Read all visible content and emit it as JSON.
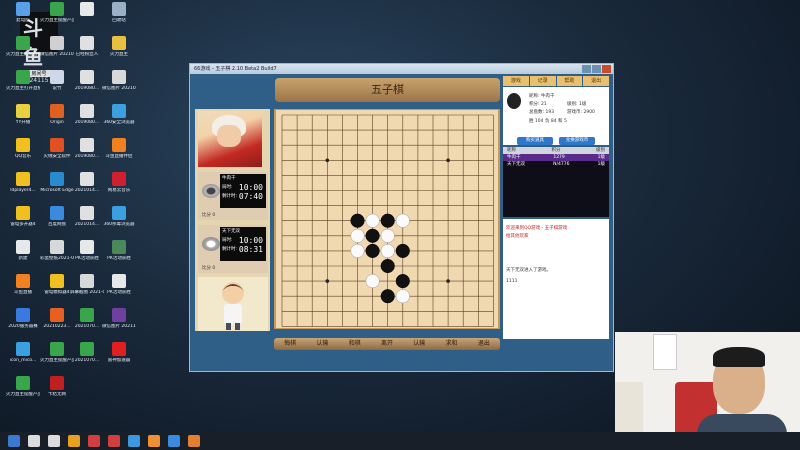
{
  "desktop": {
    "logo": {
      "big": "斗鱼",
      "small": "房间号",
      "room": "24115"
    },
    "icons": [
      {
        "label": "此电脑",
        "color": "#5aa0e8"
      },
      {
        "label": "火力直主提醒产品2020-...",
        "color": "#3aa64c"
      },
      {
        "label": "",
        "color": "#e8e8e8"
      },
      {
        "label": "回收站",
        "color": "#9ab0c8"
      },
      {
        "label": "火力直主提醒直播开播-...",
        "color": "#3aa64c"
      },
      {
        "label": "微信图片 2021041...",
        "color": "#d0d0d0"
      },
      {
        "label": "已经粉丝人",
        "color": "#e0e0e0"
      },
      {
        "label": "火力直主",
        "color": "#e8c040"
      },
      {
        "label": "火力直主打开直播",
        "color": "#3aa64c"
      },
      {
        "label": "说竹",
        "color": "#cfd8e8"
      },
      {
        "label": "2019080...",
        "color": "#e0e0e0"
      },
      {
        "label": "微信图片 2021042...",
        "color": "#d8d8d8"
      },
      {
        "label": "YY开播",
        "color": "#e8d040"
      },
      {
        "label": "Origin",
        "color": "#e06020"
      },
      {
        "label": "2019080...",
        "color": "#e0e0e0"
      },
      {
        "label": "360安全浏览器",
        "color": "#3aa0e0"
      },
      {
        "label": "QQ音乐",
        "color": "#f0c020"
      },
      {
        "label": "火绒安全软件",
        "color": "#e05020"
      },
      {
        "label": "2019080...",
        "color": "#e0e0e0"
      },
      {
        "label": "斗鱼直播伴侣",
        "color": "#f08020"
      },
      {
        "label": "ldplayer4...",
        "color": "#f0c020"
      },
      {
        "label": "Microsoft Edge",
        "color": "#2a8ad0"
      },
      {
        "label": "2021014...",
        "color": "#e0e0e0"
      },
      {
        "label": "网易云音乐",
        "color": "#d02030"
      },
      {
        "label": "雷电多开器4",
        "color": "#f0c020"
      },
      {
        "label": "百度网盘",
        "color": "#3a8ae0"
      },
      {
        "label": "2021014...",
        "color": "#e0e0e0"
      },
      {
        "label": "360杀毒浏览器",
        "color": "#3aa0e0"
      },
      {
        "label": "新建",
        "color": "#e8e8e8"
      },
      {
        "label": "彩蛋壁纸2021-05-01.bmp",
        "color": "#d8d8d8"
      },
      {
        "label": "PK活动获胜",
        "color": "#e8e8e8"
      },
      {
        "label": "PK活动获胜",
        "color": "#4a8a5a"
      },
      {
        "label": "斗鱼直播",
        "color": "#f08020"
      },
      {
        "label": "雷电模拟器4",
        "color": "#f0c020"
      },
      {
        "label": "屏幕截图 2021-07-...",
        "color": "#d8d8d8"
      },
      {
        "label": "PK活动获胜",
        "color": "#e8e8e8"
      },
      {
        "label": "2020服务器赛",
        "color": "#3a7ae0"
      },
      {
        "label": "20210223...",
        "color": "#e86020"
      },
      {
        "label": "2021070...",
        "color": "#3aa64c"
      },
      {
        "label": "微信图片 20211103...",
        "color": "#7040a0"
      },
      {
        "label": "icon_mico...",
        "color": "#3aa0e0"
      },
      {
        "label": "火力直主提醒产品",
        "color": "#3aa64c"
      },
      {
        "label": "2021070...",
        "color": "#3aa64c"
      },
      {
        "label": "雷神加速器",
        "color": "#e02020"
      },
      {
        "label": "火力直主提醒产品(正规)",
        "color": "#3aa64c"
      },
      {
        "label": "卡结无网",
        "color": "#c02020"
      }
    ]
  },
  "window": {
    "title": "66游戏 - 五子棋  2.10 Beta2 Build7",
    "banner": "五子棋",
    "player1": {
      "name": "牛肉干",
      "time_label": "局时:",
      "time": "10:00",
      "step_label": "剩计时:",
      "step": "07:40",
      "score": "比分 0"
    },
    "player2": {
      "name": "天下无双",
      "time_label": "局时:",
      "time": "10:00",
      "step_label": "剩计时:",
      "step": "08:31",
      "score": "比分 0"
    },
    "buttons": [
      "悔棋",
      "认输",
      "和棋",
      "离开",
      "认输",
      "求和",
      "退出"
    ],
    "right_tabs": [
      "游戏",
      "记录",
      "帮助",
      "退出"
    ],
    "info": {
      "name_label": "昵称:",
      "name": "牛肉干",
      "score_label": "积分:",
      "score": "21",
      "level_label": "级别:",
      "level": "1级",
      "games_label": "总盘数:",
      "games": "193",
      "money_label": "游戏币:",
      "money": "2900",
      "win": "胜 104  负 84  和 5",
      "btn1": "购买道具",
      "btn2": "兑换游戏币"
    },
    "player_list": {
      "headers": [
        "昵称",
        "积分",
        "级别"
      ],
      "rows": [
        {
          "name": "牛肉干",
          "score": "1279",
          "level": "1级",
          "selected": true
        },
        {
          "name": "天下无双",
          "score": "N/4776",
          "level": "1级",
          "selected": false
        }
      ]
    },
    "chat": [
      {
        "text": "欢迎来到QQ游戏 - 五子棋游戏",
        "color": "#c02020"
      },
      {
        "text": "给其他玩家",
        "color": "#c02020"
      },
      {
        "text": "天下无双进入了游戏。",
        "color": "#333333"
      },
      {
        "text": "1111",
        "color": "#333333"
      }
    ]
  },
  "board": {
    "size": 15,
    "stones": [
      {
        "c": 5,
        "r": 7,
        "color": "black"
      },
      {
        "c": 6,
        "r": 7,
        "color": "white"
      },
      {
        "c": 7,
        "r": 7,
        "color": "black"
      },
      {
        "c": 8,
        "r": 7,
        "color": "white"
      },
      {
        "c": 5,
        "r": 8,
        "color": "white"
      },
      {
        "c": 6,
        "r": 8,
        "color": "black"
      },
      {
        "c": 7,
        "r": 8,
        "color": "white"
      },
      {
        "c": 5,
        "r": 9,
        "color": "white"
      },
      {
        "c": 6,
        "r": 9,
        "color": "black"
      },
      {
        "c": 7,
        "r": 9,
        "color": "white"
      },
      {
        "c": 8,
        "r": 9,
        "color": "black"
      },
      {
        "c": 7,
        "r": 10,
        "color": "black"
      },
      {
        "c": 6,
        "r": 11,
        "color": "white"
      },
      {
        "c": 8,
        "r": 11,
        "color": "black"
      },
      {
        "c": 7,
        "r": 12,
        "color": "black"
      },
      {
        "c": 8,
        "r": 12,
        "color": "white"
      }
    ],
    "star_points": [
      [
        3,
        3
      ],
      [
        11,
        3
      ],
      [
        7,
        7
      ],
      [
        3,
        11
      ],
      [
        11,
        11
      ]
    ]
  },
  "taskbar": {
    "items": [
      "start-icon",
      "search-icon",
      "taskview-icon",
      "chrome-icon",
      "weibo-icon",
      "store-icon",
      "app-icon",
      "photo-icon",
      "qq-icon",
      "game-icon"
    ]
  }
}
